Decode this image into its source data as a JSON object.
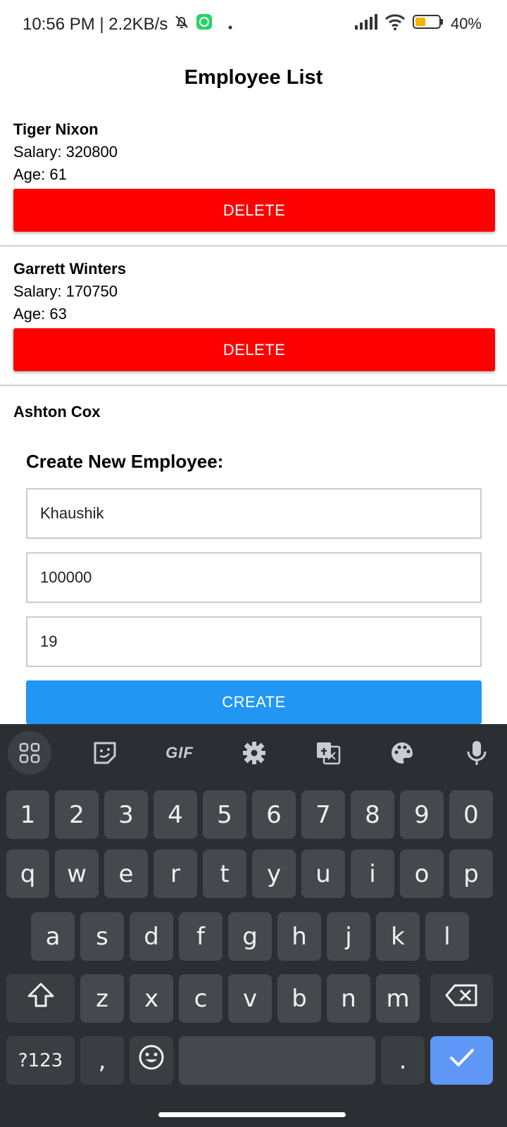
{
  "status_bar": {
    "time_info": "10:56 PM | 2.2KB/s",
    "battery_text": "40%",
    "battery_level": 0.4
  },
  "page": {
    "title": "Employee List"
  },
  "employees": [
    {
      "name": "Tiger Nixon",
      "salary": "Salary: 320800",
      "age": "Age: 61",
      "delete_label": "DELETE"
    },
    {
      "name": "Garrett Winters",
      "salary": "Salary: 170750",
      "age": "Age: 63",
      "delete_label": "DELETE"
    },
    {
      "name": "Ashton Cox"
    }
  ],
  "create_form": {
    "heading": "Create New Employee:",
    "name_value": "Khaushik",
    "salary_value": "100000",
    "age_value": "19",
    "submit_label": "CREATE"
  },
  "keyboard": {
    "toolbar": {
      "gif_label": "GIF"
    },
    "rows": [
      [
        "1",
        "2",
        "3",
        "4",
        "5",
        "6",
        "7",
        "8",
        "9",
        "0"
      ],
      [
        "q",
        "w",
        "e",
        "r",
        "t",
        "y",
        "u",
        "i",
        "o",
        "p"
      ],
      [
        "a",
        "s",
        "d",
        "f",
        "g",
        "h",
        "j",
        "k",
        "l"
      ],
      [
        "z",
        "x",
        "c",
        "v",
        "b",
        "n",
        "m"
      ]
    ],
    "symbols_label": "?123",
    "comma": ",",
    "period": "."
  },
  "colors": {
    "delete": "#ff0000",
    "create": "#2196f3",
    "keyboard_bg": "#2b2e32",
    "key_bg": "#45494e",
    "enter_key": "#5e97f6"
  }
}
